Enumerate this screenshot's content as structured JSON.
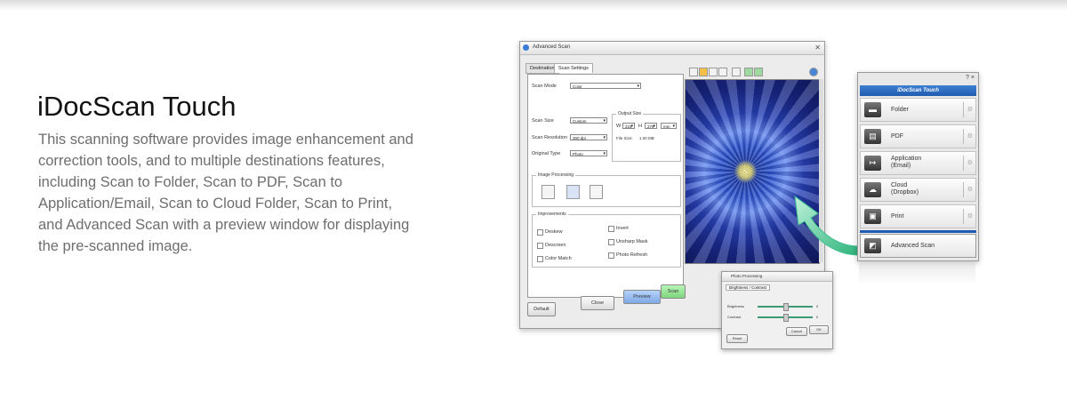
{
  "heading": "iDocScan Touch",
  "description": "This scanning software provides image enhancement and correction tools, and to multiple destinations features, including Scan to Folder, Scan to PDF, Scan to Application/Email, Scan to Cloud Folder, Scan to Print, and Advanced Scan with a preview window for displaying the pre-scanned image.",
  "advanced_window": {
    "title": "Advanced Scan",
    "tabs": [
      "Destination",
      "Scan Settings"
    ],
    "scan_mode_label": "Scan Mode",
    "scan_mode_value": "Color",
    "scan_size_label": "Scan Size",
    "scan_size_value": "Custom",
    "scan_resolution_label": "Scan Resolution",
    "scan_resolution_value": "300 dpi",
    "original_type_label": "Original Type",
    "original_type_value": "Photo",
    "output_size_label": "Output Size",
    "width_label": "W",
    "width_value": "215",
    "height_label": "H",
    "height_value": "279",
    "unit_value": "mm",
    "file_size_label": "File Size:",
    "file_size_value": "1.00 MB",
    "image_processing_label": "Image Processing",
    "improvements_label": "Improvements",
    "improvements": [
      "Deskew",
      "Descreen",
      "Color Match",
      "Invert",
      "Unsharp Mask",
      "Photo Refresh"
    ],
    "buttons": {
      "default": "Default",
      "close": "Close",
      "preview": "Preview",
      "scan": "Scan"
    }
  },
  "adjust_dialog": {
    "title": "Photo Processing",
    "tab": "Brightness / Contrast",
    "brightness_label": "Brightness",
    "brightness_value": "0",
    "contrast_label": "Contrast",
    "contrast_value": "0",
    "buttons": {
      "reset": "Reset",
      "cancel": "Cancel",
      "ok": "OK"
    }
  },
  "touch_panel": {
    "help": "?",
    "close": "×",
    "header": "iDocScan Touch",
    "items": [
      {
        "label": "Folder",
        "icon": "folder-icon",
        "glyph": "▬"
      },
      {
        "label": "PDF",
        "icon": "pdf-icon",
        "glyph": "▤"
      },
      {
        "label": "Application (Email)",
        "line1": "Application",
        "line2": "(Email)",
        "icon": "application-icon",
        "glyph": "↦"
      },
      {
        "label": "Cloud (Dropbox)",
        "line1": "Cloud",
        "line2": "(Dropbox)",
        "icon": "cloud-icon",
        "glyph": "☁"
      },
      {
        "label": "Print",
        "icon": "print-icon",
        "glyph": "▣"
      },
      {
        "label": "Advanced Scan",
        "icon": "advanced-scan-icon",
        "glyph": "◩"
      }
    ]
  },
  "colors": {
    "accent": "#1f5bb0",
    "arrow": "#3fbf8f",
    "scan_button": "#8fe08f",
    "preview_button": "#8fb8f0"
  }
}
